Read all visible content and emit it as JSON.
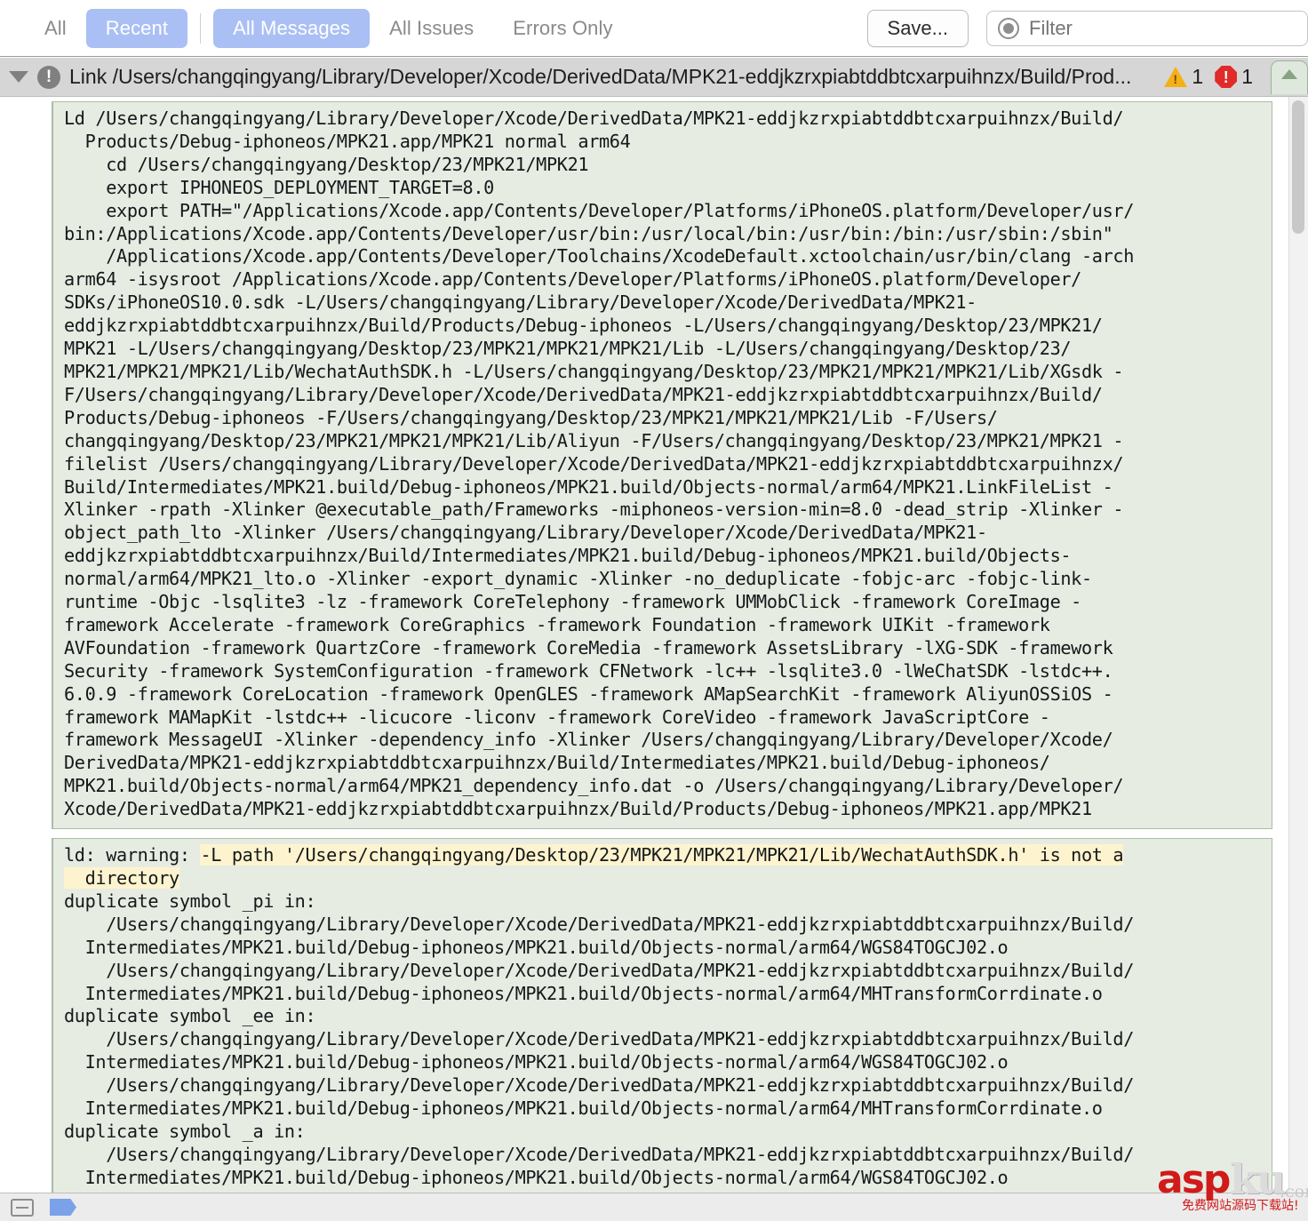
{
  "toolbar": {
    "segments": [
      {
        "label": "All",
        "active": false
      },
      {
        "label": "Recent",
        "active": true
      },
      {
        "label": "All Messages",
        "active": true
      },
      {
        "label": "All Issues",
        "active": false
      },
      {
        "label": "Errors Only",
        "active": false
      }
    ],
    "save_label": "Save...",
    "filter_placeholder": "Filter"
  },
  "issue_header": {
    "title": "Link /Users/changqingyang/Library/Developer/Xcode/DerivedData/MPK21-eddjkzrxpiabtddbtcxarpuihnzx/Build/Prod...",
    "warning_count": "1",
    "error_count": "1",
    "status_icon": "exclamation-circle-icon"
  },
  "log": {
    "block1": "Ld /Users/changqingyang/Library/Developer/Xcode/DerivedData/MPK21-eddjkzrxpiabtddbtcxarpuihnzx/Build/\n  Products/Debug-iphoneos/MPK21.app/MPK21 normal arm64\n    cd /Users/changqingyang/Desktop/23/MPK21/MPK21\n    export IPHONEOS_DEPLOYMENT_TARGET=8.0\n    export PATH=\"/Applications/Xcode.app/Contents/Developer/Platforms/iPhoneOS.platform/Developer/usr/\nbin:/Applications/Xcode.app/Contents/Developer/usr/bin:/usr/local/bin:/usr/bin:/bin:/usr/sbin:/sbin\"\n    /Applications/Xcode.app/Contents/Developer/Toolchains/XcodeDefault.xctoolchain/usr/bin/clang -arch\narm64 -isysroot /Applications/Xcode.app/Contents/Developer/Platforms/iPhoneOS.platform/Developer/\nSDKs/iPhoneOS10.0.sdk -L/Users/changqingyang/Library/Developer/Xcode/DerivedData/MPK21-\neddjkzrxpiabtddbtcxarpuihnzx/Build/Products/Debug-iphoneos -L/Users/changqingyang/Desktop/23/MPK21/\nMPK21 -L/Users/changqingyang/Desktop/23/MPK21/MPK21/MPK21/Lib -L/Users/changqingyang/Desktop/23/\nMPK21/MPK21/MPK21/Lib/WechatAuthSDK.h -L/Users/changqingyang/Desktop/23/MPK21/MPK21/MPK21/Lib/XGsdk -\nF/Users/changqingyang/Library/Developer/Xcode/DerivedData/MPK21-eddjkzrxpiabtddbtcxarpuihnzx/Build/\nProducts/Debug-iphoneos -F/Users/changqingyang/Desktop/23/MPK21/MPK21/MPK21/Lib -F/Users/\nchangqingyang/Desktop/23/MPK21/MPK21/MPK21/Lib/Aliyun -F/Users/changqingyang/Desktop/23/MPK21/MPK21 -\nfilelist /Users/changqingyang/Library/Developer/Xcode/DerivedData/MPK21-eddjkzrxpiabtddbtcxarpuihnzx/\nBuild/Intermediates/MPK21.build/Debug-iphoneos/MPK21.build/Objects-normal/arm64/MPK21.LinkFileList -\nXlinker -rpath -Xlinker @executable_path/Frameworks -miphoneos-version-min=8.0 -dead_strip -Xlinker -\nobject_path_lto -Xlinker /Users/changqingyang/Library/Developer/Xcode/DerivedData/MPK21-\neddjkzrxpiabtddbtcxarpuihnzx/Build/Intermediates/MPK21.build/Debug-iphoneos/MPK21.build/Objects-\nnormal/arm64/MPK21_lto.o -Xlinker -export_dynamic -Xlinker -no_deduplicate -fobjc-arc -fobjc-link-\nruntime -Objc -lsqlite3 -lz -framework CoreTelephony -framework UMMobClick -framework CoreImage -\nframework Accelerate -framework CoreGraphics -framework Foundation -framework UIKit -framework\nAVFoundation -framework QuartzCore -framework CoreMedia -framework AssetsLibrary -lXG-SDK -framework\nSecurity -framework SystemConfiguration -framework CFNetwork -lc++ -lsqlite3.0 -lWeChatSDK -lstdc++.\n6.0.9 -framework CoreLocation -framework OpenGLES -framework AMapSearchKit -framework AliyunOSSiOS -\nframework MAMapKit -lstdc++ -licucore -liconv -framework CoreVideo -framework JavaScriptCore -\nframework MessageUI -Xlinker -dependency_info -Xlinker /Users/changqingyang/Library/Developer/Xcode/\nDerivedData/MPK21-eddjkzrxpiabtddbtcxarpuihnzx/Build/Intermediates/MPK21.build/Debug-iphoneos/\nMPK21.build/Objects-normal/arm64/MPK21_dependency_info.dat -o /Users/changqingyang/Library/Developer/\nXcode/DerivedData/MPK21-eddjkzrxpiabtddbtcxarpuihnzx/Build/Products/Debug-iphoneos/MPK21.app/MPK21",
    "block2_prefix": "ld: warning: ",
    "block2_highlight": "-L path '/Users/changqingyang/Desktop/23/MPK21/MPK21/MPK21/Lib/WechatAuthSDK.h' is not a\n  directory",
    "block2_rest": "\nduplicate symbol _pi in:\n    /Users/changqingyang/Library/Developer/Xcode/DerivedData/MPK21-eddjkzrxpiabtddbtcxarpuihnzx/Build/\n  Intermediates/MPK21.build/Debug-iphoneos/MPK21.build/Objects-normal/arm64/WGS84TOGCJ02.o\n    /Users/changqingyang/Library/Developer/Xcode/DerivedData/MPK21-eddjkzrxpiabtddbtcxarpuihnzx/Build/\n  Intermediates/MPK21.build/Debug-iphoneos/MPK21.build/Objects-normal/arm64/MHTransformCorrdinate.o\nduplicate symbol _ee in:\n    /Users/changqingyang/Library/Developer/Xcode/DerivedData/MPK21-eddjkzrxpiabtddbtcxarpuihnzx/Build/\n  Intermediates/MPK21.build/Debug-iphoneos/MPK21.build/Objects-normal/arm64/WGS84TOGCJ02.o\n    /Users/changqingyang/Library/Developer/Xcode/DerivedData/MPK21-eddjkzrxpiabtddbtcxarpuihnzx/Build/\n  Intermediates/MPK21.build/Debug-iphoneos/MPK21.build/Objects-normal/arm64/MHTransformCorrdinate.o\nduplicate symbol _a in:\n    /Users/changqingyang/Library/Developer/Xcode/DerivedData/MPK21-eddjkzrxpiabtddbtcxarpuihnzx/Build/\n  Intermediates/MPK21.build/Debug-iphoneos/MPK21.build/Objects-normal/arm64/WGS84TOGCJ02.o\n    /Users/changqingyang/Library/Developer/Xcode/DerivedData/MPK21-eddjkzrxpiabtddbtcxarpuihnzx/Build/"
  },
  "watermark": {
    "asp": "asp",
    "ku": "ku",
    "com": ".com",
    "cn_text": "免费网站源码下载站!"
  },
  "colors": {
    "accent_blue": "#aabff4",
    "log_bg": "#e7ece3",
    "highlight_yellow": "#fdf4cf",
    "warning_orange": "#f5b016",
    "error_red": "#e02b28"
  }
}
